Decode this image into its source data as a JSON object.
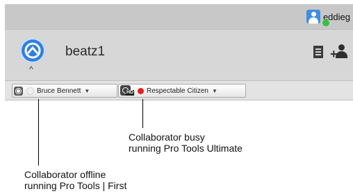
{
  "user": {
    "name": "eddieg",
    "status_color": "#35c23e",
    "avatar_color": "#3d8fe0"
  },
  "session": {
    "name": "beatz1",
    "logo_icon": "pro-tools-logo-icon",
    "logo_caret": "^",
    "doc_icon": "document-list-icon",
    "add_user_icon": "add-user-icon",
    "add_user_plus": "+"
  },
  "collaborators": [
    {
      "name": "Bruce Bennett",
      "app_icon": "pro-tools-first-icon",
      "status": "offline",
      "caret": "▼"
    },
    {
      "name": "Respectable Citizen",
      "app_icon": "pro-tools-ultimate-hd-icon",
      "app_icon_badge": "HD",
      "status": "busy",
      "status_color": "#e3221c",
      "caret": "▼"
    }
  ],
  "callouts": {
    "offline": {
      "line1": "Collaborator offline",
      "line2": "running Pro Tools | First"
    },
    "busy": {
      "line1": "Collaborator busy",
      "line2": "running Pro Tools Ultimate"
    }
  }
}
